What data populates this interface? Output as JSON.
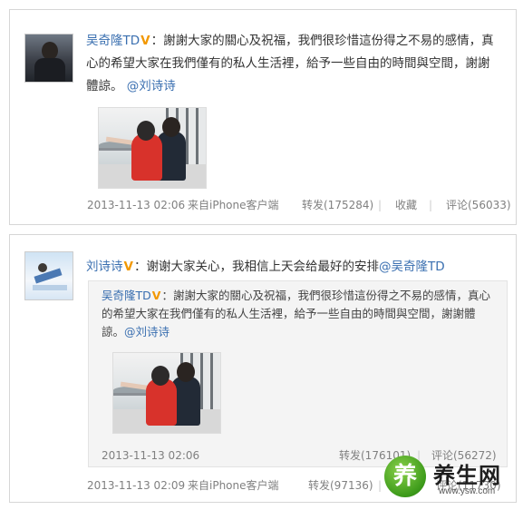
{
  "post1": {
    "user": "吴奇隆TD",
    "badge": "V",
    "colon": "：",
    "text": "謝謝大家的關心及祝福，我們很珍惜這份得之不易的感情，真心的希望大家在我們僅有的私人生活裡，給予一些自由的時間與空間，謝謝體諒。",
    "mention": "@刘诗诗",
    "time": "2013-11-13 02:06",
    "source": "来自iPhone客户端",
    "repost": "转发(175284)",
    "favorite": "收藏",
    "comment": "评论(56033)",
    "separator": "|"
  },
  "post2": {
    "user": "刘诗诗",
    "badge": "V",
    "colon": "：",
    "text": "谢谢大家关心，我相信上天会给最好的安排",
    "mention": "@吴奇隆TD",
    "time": "2013-11-13 02:09",
    "source": "来自iPhone客户端",
    "repost": "转发(97136)",
    "comment": "评论(11730)",
    "separator": "|",
    "quote": {
      "user": "吴奇隆TD",
      "badge": "V",
      "colon": "：",
      "text": "謝謝大家的關心及祝福，我們很珍惜這份得之不易的感情，真心的希望大家在我們僅有的私人生活裡，給予一些自由的時間與空間，謝謝體諒。",
      "mention": "@刘诗诗",
      "time": "2013-11-13 02:06",
      "repost": "转发(176101)",
      "comment": "评论(56272)",
      "separator": "|"
    }
  },
  "watermark": {
    "glyph": "养",
    "name": "养生网",
    "url": "www.ysw.com"
  },
  "colors": {
    "link": "#3a6fb0",
    "badge": "#f29800",
    "meta": "#808080",
    "quote_bg": "#f4f4f4"
  }
}
